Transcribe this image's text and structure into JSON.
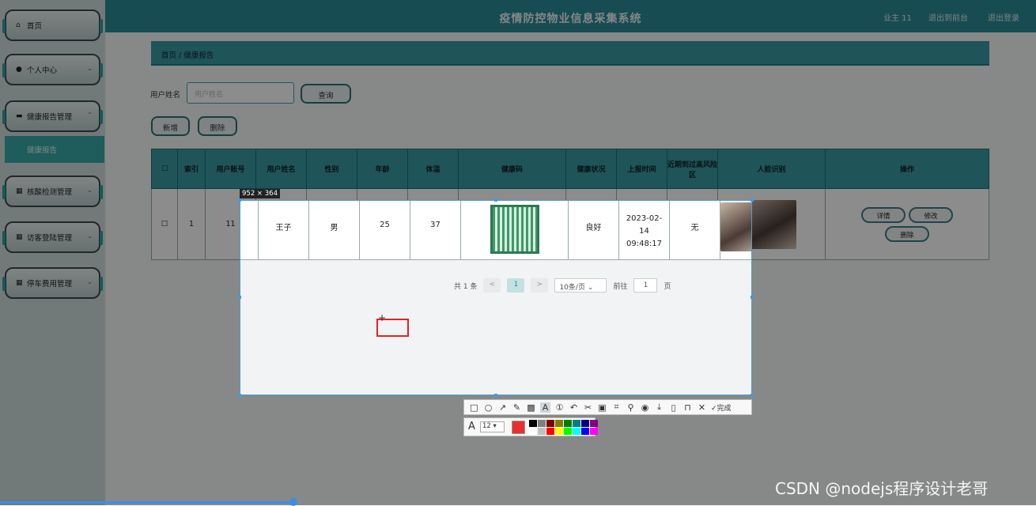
{
  "app": {
    "title": "疫情防控物业信息采集系统",
    "user": "业主 11",
    "back": "退出到前台",
    "logout": "退出登录"
  },
  "sidebar": {
    "items": [
      {
        "label": "首页",
        "icon": "home-icon"
      },
      {
        "label": "个人中心",
        "icon": "user-icon"
      },
      {
        "label": "健康报告管理",
        "icon": "monitor-icon"
      },
      {
        "label": "核酸检测管理",
        "icon": "grid-icon"
      },
      {
        "label": "访客登陆管理",
        "icon": "grid-icon"
      },
      {
        "label": "停车费用管理",
        "icon": "grid-icon"
      }
    ],
    "sub": "健康报告"
  },
  "breadcrumb": {
    "home": "首页",
    "sep": "/",
    "current": "健康报告"
  },
  "search": {
    "label": "用户姓名",
    "placeholder": "用户姓名",
    "button": "查询"
  },
  "actions": {
    "add": "新增",
    "delete": "删除"
  },
  "table": {
    "headers": [
      "",
      "索引",
      "用户账号",
      "用户姓名",
      "性别",
      "年龄",
      "体温",
      "健康码",
      "健康状况",
      "上报时间",
      "近期到过高风险区",
      "人脸识别",
      "操作"
    ],
    "row": {
      "index": "1",
      "account": "11",
      "name": "王子",
      "gender": "男",
      "age": "25",
      "temp": "37",
      "status": "良好",
      "time": "2023-02-14 09:48:17",
      "risk": "无"
    },
    "ops": {
      "detail": "详情",
      "edit": "修改",
      "delete": "删除"
    }
  },
  "pager": {
    "total": "共 1 条",
    "page": "1",
    "size": "10条/页",
    "goto": "前往",
    "goto_val": "1",
    "unit": "页",
    "prev": "<",
    "next": ">"
  },
  "screenshot_tool": {
    "dimension": "952 × 364",
    "done": "完成",
    "font_size": "12",
    "font_icon": "A"
  },
  "watermark": "CSDN @nodejs程序设计老哥",
  "colors": {
    "accent": "#2a8a95",
    "palette": [
      "#000000",
      "#808080",
      "#800000",
      "#808000",
      "#008000",
      "#008080",
      "#000080",
      "#800080",
      "#ffffff",
      "#c0c0c0",
      "#ff0000",
      "#ffff00",
      "#00ff00",
      "#00ffff",
      "#0000ff",
      "#ff00ff"
    ]
  }
}
